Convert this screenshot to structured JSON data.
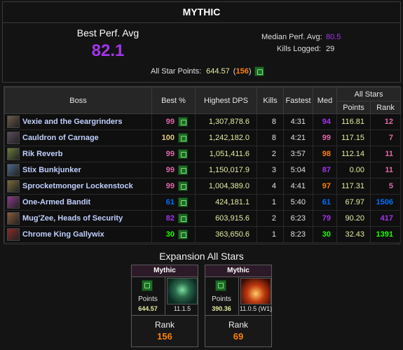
{
  "panel": {
    "title": "MYTHIC",
    "best_perf_avg_label": "Best Perf. Avg",
    "best_perf_avg_value": "82.1",
    "median_perf_avg_label": "Median Perf. Avg:",
    "median_perf_avg_value": "80.5",
    "kills_logged_label": "Kills Logged:",
    "kills_logged_value": "29",
    "all_star_points_label": "All Star Points:",
    "all_star_points_value": "644.57",
    "all_star_rank": "156"
  },
  "table": {
    "headers": {
      "boss": "Boss",
      "best": "Best %",
      "dps": "Highest DPS",
      "kills": "Kills",
      "fastest": "Fastest",
      "med": "Med",
      "all_stars": "All Stars",
      "points": "Points",
      "rank": "Rank"
    },
    "rows": [
      {
        "boss": "Vexie and the Geargrinders",
        "best": "99",
        "best_color": "#e268a8",
        "dps": "1,307,878.6",
        "kills": "8",
        "fastest": "4:31",
        "med": "94",
        "med_color": "#a335ee",
        "points": "116.81",
        "rank": "12",
        "rank_color": "#e268a8",
        "icon_color": "#6b5a4a"
      },
      {
        "boss": "Cauldron of Carnage",
        "best": "100",
        "best_color": "#e5cc80",
        "dps": "1,242,182.0",
        "kills": "8",
        "fastest": "4:21",
        "med": "99",
        "med_color": "#e268a8",
        "points": "117.15",
        "rank": "7",
        "rank_color": "#e268a8",
        "icon_color": "#5a4a5a"
      },
      {
        "boss": "Rik Reverb",
        "best": "99",
        "best_color": "#e268a8",
        "dps": "1,051,411.6",
        "kills": "2",
        "fastest": "3:57",
        "med": "98",
        "med_color": "#ff8000",
        "points": "112.14",
        "rank": "11",
        "rank_color": "#e268a8",
        "icon_color": "#6a7a3a"
      },
      {
        "boss": "Stix Bunkjunker",
        "best": "99",
        "best_color": "#e268a8",
        "dps": "1,150,017.9",
        "kills": "3",
        "fastest": "5:04",
        "med": "87",
        "med_color": "#a335ee",
        "points": "0.00",
        "rank": "11",
        "rank_color": "#e268a8",
        "icon_color": "#4a6a8a"
      },
      {
        "boss": "Sprocketmonger Lockenstock",
        "best": "99",
        "best_color": "#e268a8",
        "dps": "1,004,389.0",
        "kills": "4",
        "fastest": "4:41",
        "med": "97",
        "med_color": "#ff8000",
        "points": "117.31",
        "rank": "5",
        "rank_color": "#e268a8",
        "icon_color": "#7a6a3a"
      },
      {
        "boss": "One-Armed Bandit",
        "best": "61",
        "best_color": "#0070ff",
        "dps": "424,181.1",
        "kills": "1",
        "fastest": "5:40",
        "med": "61",
        "med_color": "#0070ff",
        "points": "67.97",
        "rank": "1506",
        "rank_color": "#0070ff",
        "icon_color": "#8a3a8a"
      },
      {
        "boss": "Mug'Zee, Heads of Security",
        "best": "82",
        "best_color": "#a335ee",
        "dps": "603,915.6",
        "kills": "2",
        "fastest": "6:23",
        "med": "79",
        "med_color": "#a335ee",
        "points": "90.20",
        "rank": "417",
        "rank_color": "#a335ee",
        "icon_color": "#8a5a3a"
      },
      {
        "boss": "Chrome King Gallywix",
        "best": "30",
        "best_color": "#1eff00",
        "dps": "363,650.6",
        "kills": "1",
        "fastest": "8:23",
        "med": "30",
        "med_color": "#1eff00",
        "points": "32.43",
        "rank": "1391",
        "rank_color": "#1eff00",
        "icon_color": "#8a2a2a"
      }
    ]
  },
  "expansion": {
    "title": "Expansion All Stars",
    "cards": [
      {
        "header": "Mythic",
        "points_label": "Points",
        "points": "644.57",
        "version": "11.1.5",
        "rank_label": "Rank",
        "rank": "156",
        "art_icon": "gallywix-green-art"
      },
      {
        "header": "Mythic",
        "points_label": "Points",
        "points": "390.36",
        "version": "11.0.5 (W1)",
        "rank_label": "Rank",
        "rank": "69",
        "art_icon": "nerubar-red-art"
      }
    ]
  }
}
